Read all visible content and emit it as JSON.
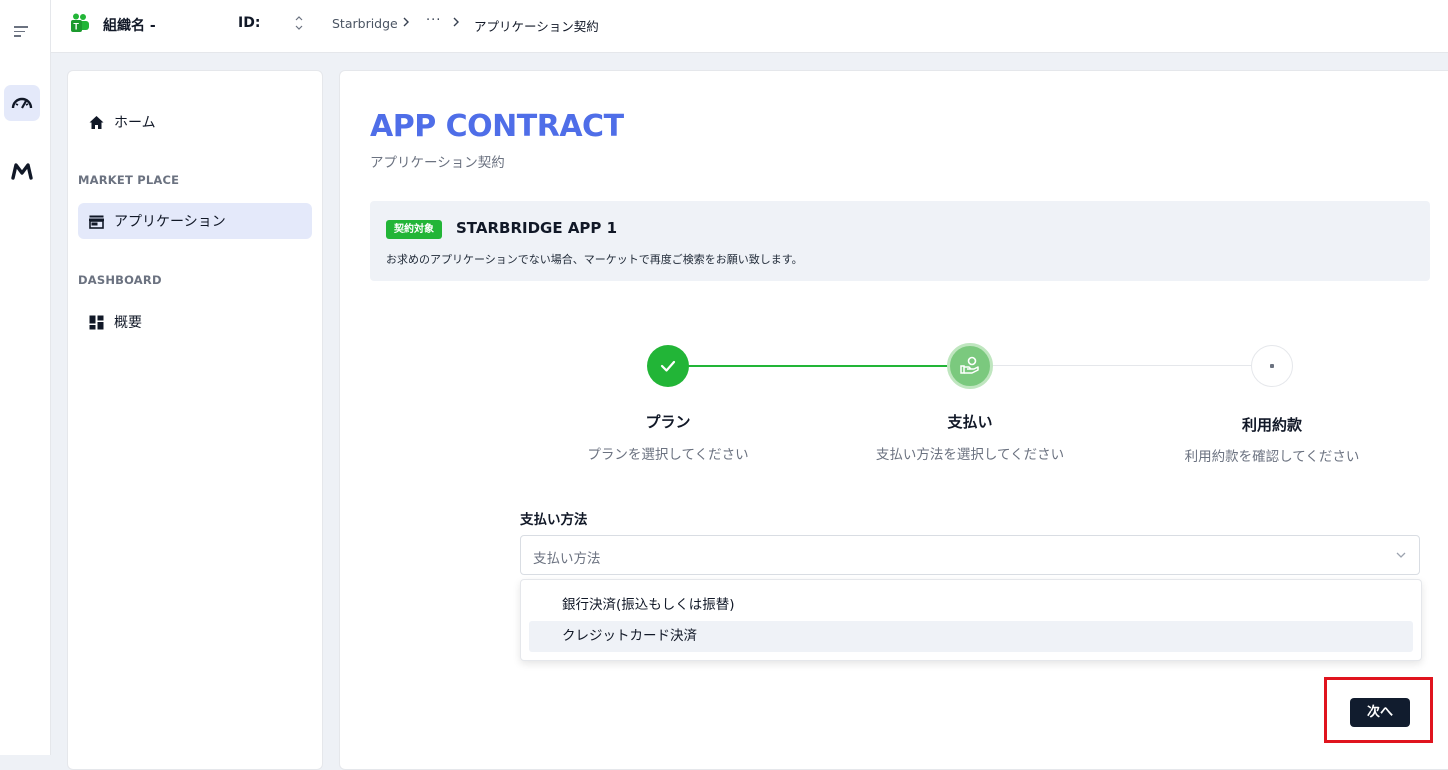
{
  "header": {
    "org_name": "組織名 -",
    "org_id_label": "ID:",
    "breadcrumb": {
      "root": "Starbridge",
      "ellipsis": "···",
      "current": "アプリケーション契約"
    }
  },
  "sidebar": {
    "home_label": "ホーム",
    "sections": [
      {
        "title": "MARKET PLACE",
        "items": [
          {
            "label": "アプリケーション",
            "icon": "storefront-icon",
            "active": true
          }
        ]
      },
      {
        "title": "DASHBOARD",
        "items": [
          {
            "label": "概要",
            "icon": "dashboard-grid-icon",
            "active": false
          }
        ]
      }
    ]
  },
  "page": {
    "title": "APP CONTRACT",
    "subtitle": "アプリケーション契約"
  },
  "app_card": {
    "badge": "契約対象",
    "name": "STARBRIDGE APP 1",
    "note": "お求めのアプリケーションでない場合、マーケットで再度ご検索をお願い致します。"
  },
  "stepper": {
    "steps": [
      {
        "title": "プラン",
        "description": "プランを選択してください",
        "state": "done"
      },
      {
        "title": "支払い",
        "description": "支払い方法を選択してください",
        "state": "current"
      },
      {
        "title": "利用約款",
        "description": "利用約款を確認してください",
        "state": "todo"
      }
    ],
    "done_color": "#22b537"
  },
  "form": {
    "payment_label": "支払い方法",
    "payment_placeholder": "支払い方法",
    "options": [
      "銀行決済(振込もしくは振替)",
      "クレジットカード決済"
    ],
    "hovered_option_index": 1
  },
  "actions": {
    "next_label": "次へ"
  },
  "colors": {
    "accent": "#4f6ee8",
    "success": "#22b537",
    "primary_button": "#111c2e",
    "highlight": "#e0141e"
  }
}
